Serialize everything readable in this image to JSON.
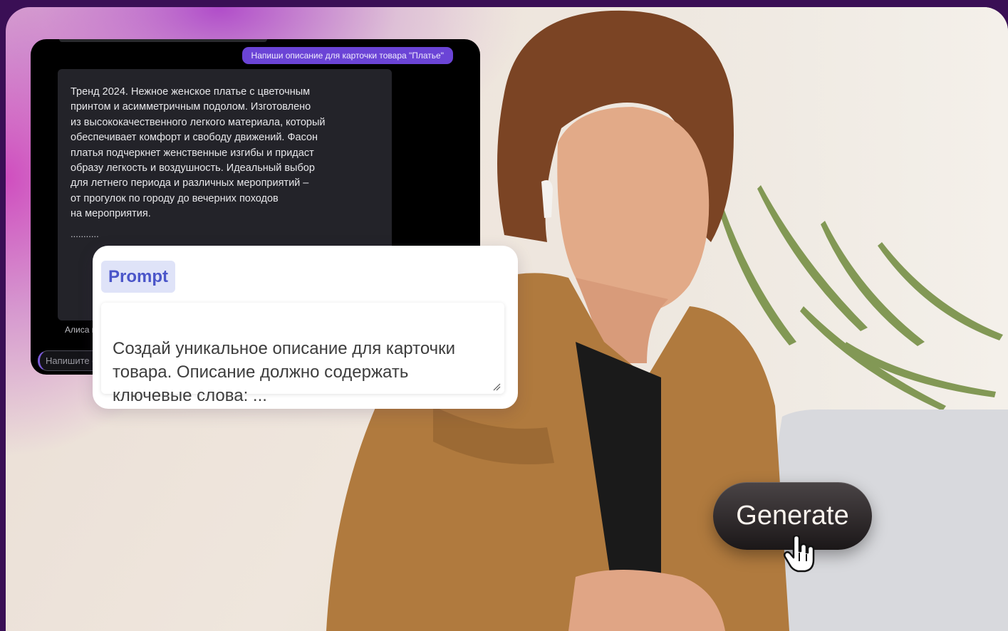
{
  "chat": {
    "user_message": "Напиши описание для карточки товара \"Платье\"",
    "assistant_message": "Тренд 2024. Нежное женское платье с цветочным\nпринтом и асимметричным подолом. Изготовлено\nиз высококачественного легкого материала, который\nобеспечивает комфорт и свободу движений. Фасон\nплатья подчеркнет женственные изгибы и придаст\nобразу легкость и воздушность. Идеальный выбор\nдля летнего периода и различных мероприятий –\nот прогулок по городу до вечерних походов\nна мероприятия.",
    "ellipsis": "...........",
    "footer": "Алиса пе",
    "input_placeholder": "Напишите с"
  },
  "prompt": {
    "tag": "Prompt",
    "text": "Создай уникальное описание для карточки\nтовара. Описание должно содержать\nключевые слова: ..."
  },
  "generate": {
    "label": "Generate"
  },
  "colors": {
    "accent": "#6b44d6",
    "prompt_tag": "#4a55c9",
    "frame": "#3a0f55"
  }
}
